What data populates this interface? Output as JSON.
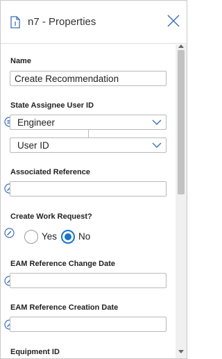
{
  "header": {
    "title": "n7 - Properties"
  },
  "fields": {
    "name": {
      "label": "Name",
      "value": "Create Recommendation"
    },
    "state_assignee": {
      "label": "State Assignee User ID",
      "role_value": "Engineer",
      "type_value": "User ID"
    },
    "associated_reference": {
      "label": "Associated Reference",
      "value": ""
    },
    "create_work_request": {
      "label": "Create Work Request?",
      "options": [
        "Yes",
        "No"
      ],
      "selected": "No"
    },
    "eam_change_date": {
      "label": "EAM Reference Change Date",
      "value": ""
    },
    "eam_creation_date": {
      "label": "EAM Reference Creation Date",
      "value": ""
    },
    "equipment_id": {
      "label": "Equipment ID"
    }
  },
  "colors": {
    "accent": "#1a73c8",
    "icon": "#3b6fb6",
    "border": "#b9b9b9"
  },
  "icons": [
    "document-icon",
    "close-icon",
    "chevron-down-icon",
    "pencil-icon",
    "list-icon"
  ]
}
